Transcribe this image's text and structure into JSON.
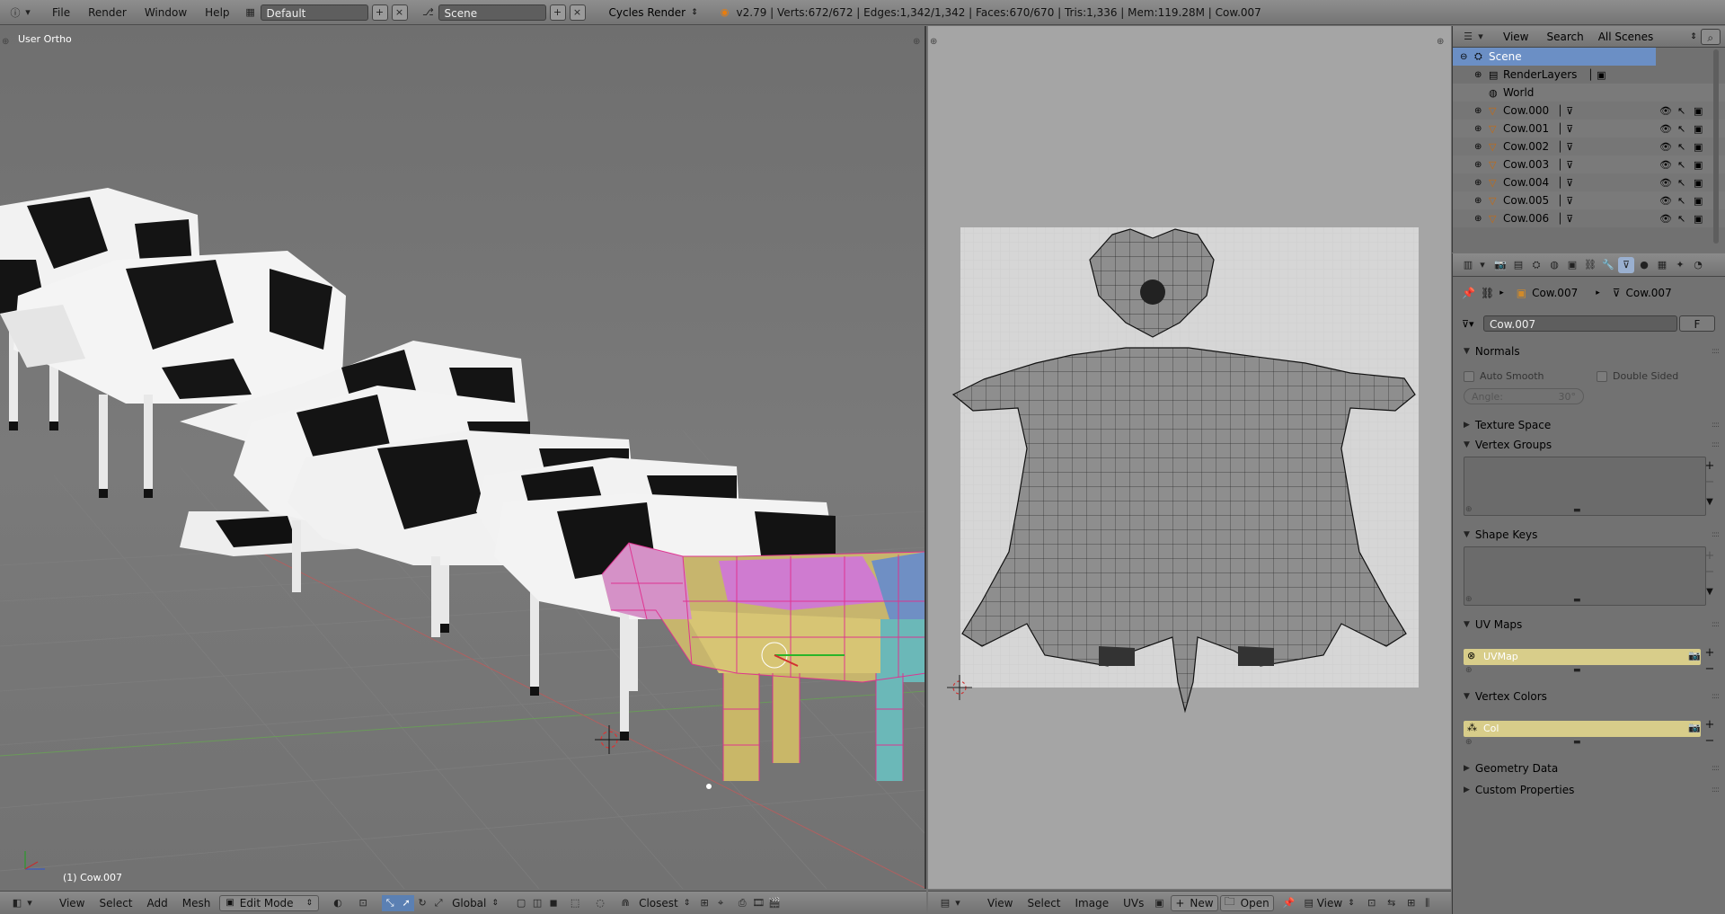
{
  "topbar": {
    "menus": [
      "File",
      "Render",
      "Window",
      "Help"
    ],
    "screen_layout": "Default",
    "scene": "Scene",
    "render_engine": "Cycles Render",
    "stats": "v2.79 | Verts:672/672 | Edges:1,342/1,342 | Faces:670/670 | Tris:1,336 | Mem:119.28M | Cow.007"
  },
  "viewport": {
    "view_label": "User Ortho",
    "object_label": "(1) Cow.007",
    "footer": {
      "view": "View",
      "select": "Select",
      "add": "Add",
      "mesh": "Mesh",
      "mode": "Edit Mode",
      "orientation": "Global",
      "snap": "Closest"
    }
  },
  "uv_editor": {
    "footer": {
      "view": "View",
      "select": "Select",
      "image": "Image",
      "uvs": "UVs",
      "new": "New",
      "open": "Open",
      "view2": "View"
    }
  },
  "outliner": {
    "header": {
      "view": "View",
      "search": "Search",
      "filter": "All Scenes"
    },
    "rows": [
      {
        "label": "Scene"
      },
      {
        "label": "RenderLayers"
      },
      {
        "label": "World"
      },
      {
        "label": "Cow.000"
      },
      {
        "label": "Cow.001"
      },
      {
        "label": "Cow.002"
      },
      {
        "label": "Cow.003"
      },
      {
        "label": "Cow.004"
      },
      {
        "label": "Cow.005"
      },
      {
        "label": "Cow.006"
      }
    ]
  },
  "properties": {
    "breadcrumb": {
      "object": "Cow.007",
      "mesh": "Cow.007"
    },
    "datablock_name": "Cow.007",
    "datablock_fake": "F",
    "panels": {
      "normals": "Normals",
      "auto_smooth": "Auto Smooth",
      "double_sided": "Double Sided",
      "angle": "Angle:",
      "angle_value": "30°",
      "texture_space": "Texture Space",
      "vertex_groups": "Vertex Groups",
      "shape_keys": "Shape Keys",
      "uv_maps": "UV Maps",
      "uv_map_item": "UVMap",
      "vertex_colors": "Vertex Colors",
      "vertex_color_item": "Col",
      "geometry_data": "Geometry Data",
      "custom_properties": "Custom Properties"
    }
  },
  "colors": {
    "selection_pink": "#e0308f",
    "uv_background": "#a5a5a5",
    "list_highlight": "#d8cd8a",
    "outliner_selected": "#5b80b3"
  }
}
